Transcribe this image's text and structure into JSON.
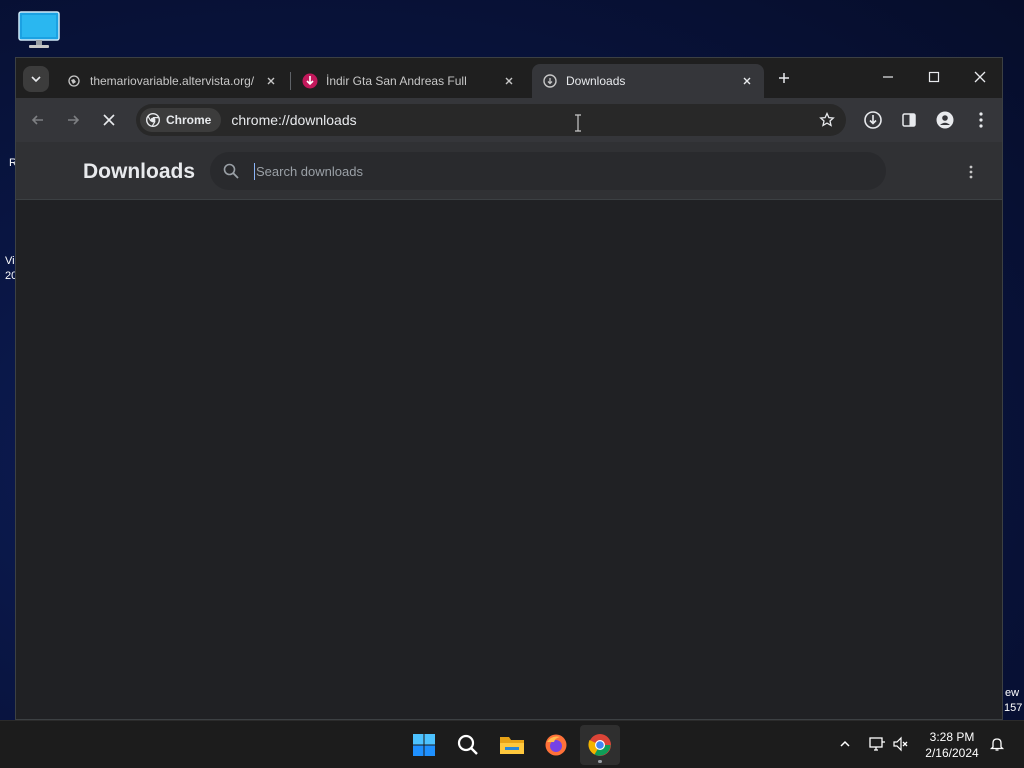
{
  "desktop": {
    "fragments": [
      "R",
      "Vi",
      "20",
      "ew",
      "157"
    ]
  },
  "tabs": [
    {
      "title": "themariovariable.altervista.org/",
      "active": false
    },
    {
      "title": "İndir Gta San Andreas Full",
      "active": false
    },
    {
      "title": "Downloads",
      "active": true
    }
  ],
  "toolbar": {
    "chip_label": "Chrome",
    "url": "chrome://downloads"
  },
  "downloads_page": {
    "title": "Downloads",
    "search_placeholder": "Search downloads"
  },
  "taskbar": {
    "time": "3:28 PM",
    "date": "2/16/2024"
  },
  "colors": {
    "tab_active": "#35363a",
    "page_bg": "#202124",
    "accent": "#8ab4f8"
  }
}
